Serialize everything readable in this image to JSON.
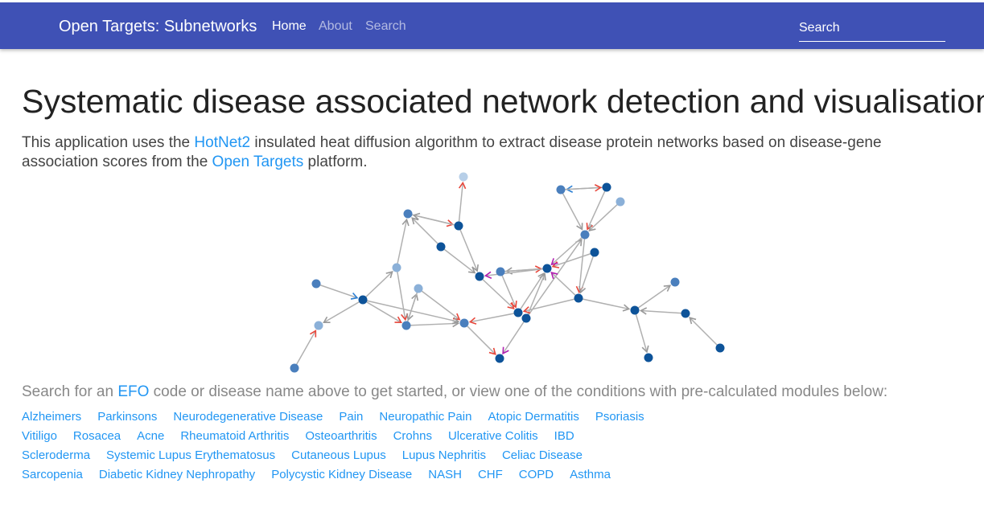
{
  "navbar": {
    "brand": "Open Targets: Subnetworks",
    "links": [
      "Home",
      "About",
      "Search"
    ],
    "search_placeholder": "Search",
    "color": "#3f51b5"
  },
  "main": {
    "title": "Systematic disease associated network detection and visualisation",
    "intro": {
      "part1": "This application uses the ",
      "link1": "HotNet2",
      "part2": " insulated heat diffusion algorithm to extract disease protein networks based on disease-gene association scores from the ",
      "link2": "Open Targets",
      "part3": " platform."
    },
    "prompt": {
      "part1": "Search for an ",
      "link": "EFO",
      "part2": " code or disease name above to get started, or view one of the conditions with pre-calculated modules below:"
    },
    "disease_rows": [
      [
        "Alzheimers",
        "Parkinsons",
        "Neurodegenerative Disease",
        "Pain",
        "Neuropathic Pain",
        "Atopic Dermatitis",
        "Psoriasis"
      ],
      [
        "Vitiligo",
        "Rosacea",
        "Acne",
        "Rheumatoid Arthritis",
        "Osteoarthritis",
        "Crohns",
        "Ulcerative Colitis",
        "IBD"
      ],
      [
        "Scleroderma",
        "Systemic Lupus Erythematosus",
        "Cutaneous Lupus",
        "Lupus Nephritis",
        "Celiac Disease"
      ],
      [
        "Sarcopenia",
        "Diabetic Kidney Nephropathy",
        "Polycystic Kidney Disease",
        "NASH",
        "CHF",
        "COPD",
        "Asthma"
      ]
    ]
  },
  "graph_colors": {
    "node_dark": "#0d5399",
    "node_mid": "#4a7fbd",
    "node_light": "#8bb0d8",
    "node_pale": "#b7cfe8",
    "edge": "#b0b0b0",
    "arrow_red": "#e8463a",
    "arrow_blue": "#2a7fd4",
    "arrow_purple": "#b01fb0",
    "link": "#2196f3"
  }
}
